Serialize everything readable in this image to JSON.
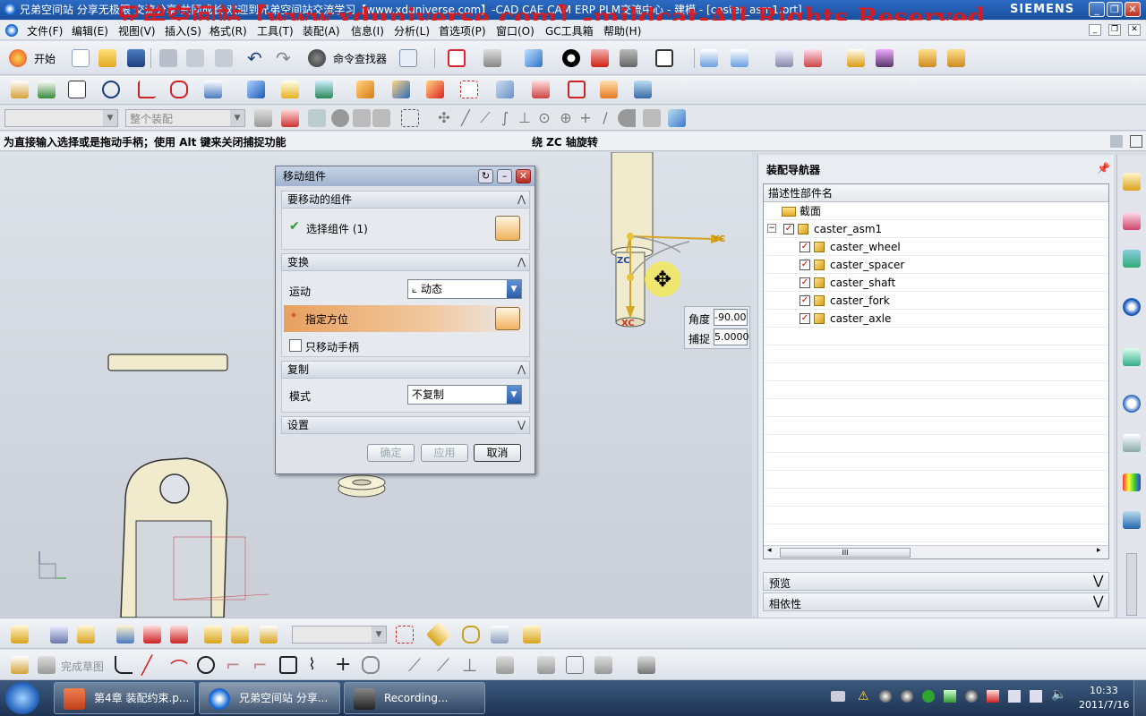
{
  "window": {
    "title": "兄弟空间站 分享无极限 交流分享 共同成长 欢迎到兄弟空间站交流学习【www.xduniverse.com】-CAD CAE CAM ERP PLM交流中心 - 建模 - [caster_asm1.prt]",
    "watermark": "兄弟空间站【www.xduniverse.com】-mildcat-All Rights Reserved",
    "brand": "SIEMENS",
    "min": "_",
    "restore": "❐",
    "close": "✕"
  },
  "menu": [
    "文件(F)",
    "编辑(E)",
    "视图(V)",
    "插入(S)",
    "格式(R)",
    "工具(T)",
    "装配(A)",
    "信息(I)",
    "分析(L)",
    "首选项(P)",
    "窗口(O)",
    "GC工具箱",
    "帮助(H)"
  ],
  "toolbar": {
    "start_label": "开始",
    "command_finder": "命令查找器",
    "filter_placeholder": "",
    "assembly_filter": "整个装配"
  },
  "cue": {
    "left": "为直接输入选择或是拖动手柄；使用 Alt 键来关闭捕捉功能",
    "right": "绕 ZC 轴旋转"
  },
  "dialog": {
    "title": "移动组件",
    "section_components": "要移动的组件",
    "select_components": "选择组件 (1)",
    "section_transform": "变换",
    "motion_label": "运动",
    "motion_value": "动态",
    "specify_orientation": "指定方位",
    "move_handle_only": "只移动手柄",
    "section_copy": "复制",
    "mode_label": "模式",
    "mode_value": "不复制",
    "section_settings": "设置",
    "ok": "确定",
    "apply": "应用",
    "cancel": "取消"
  },
  "handle": {
    "angle_label": "角度",
    "angle_value": "-90.00",
    "snap_label": "捕捉",
    "snap_value": "5.0000",
    "zc": "ZC",
    "yc": "YC",
    "xc": "XC"
  },
  "navigator": {
    "title": "装配导航器",
    "column": "描述性部件名",
    "items": [
      {
        "label": "截面",
        "level": 1,
        "type": "folder"
      },
      {
        "label": "caster_asm1",
        "level": 0,
        "type": "assembly"
      },
      {
        "label": "caster_wheel",
        "level": 1,
        "type": "part"
      },
      {
        "label": "caster_spacer",
        "level": 1,
        "type": "part"
      },
      {
        "label": "caster_shaft",
        "level": 1,
        "type": "part"
      },
      {
        "label": "caster_fork",
        "level": 1,
        "type": "part"
      },
      {
        "label": "caster_axle",
        "level": 1,
        "type": "part"
      }
    ],
    "preview": "预览",
    "dependencies": "相依性",
    "scroll_grip": "III"
  },
  "sketch_toolbar": {
    "finish_sketch": "完成草图"
  },
  "taskbar": {
    "tasks": [
      "第4章 装配约束.p...",
      "兄弟空间站 分享...",
      "Recording..."
    ],
    "time": "10:33",
    "date": "2011/7/16"
  },
  "colors": {
    "titlebar": "#1a4f9e",
    "accent_orange": "#e8a060",
    "watermark_red": "#e01818"
  }
}
